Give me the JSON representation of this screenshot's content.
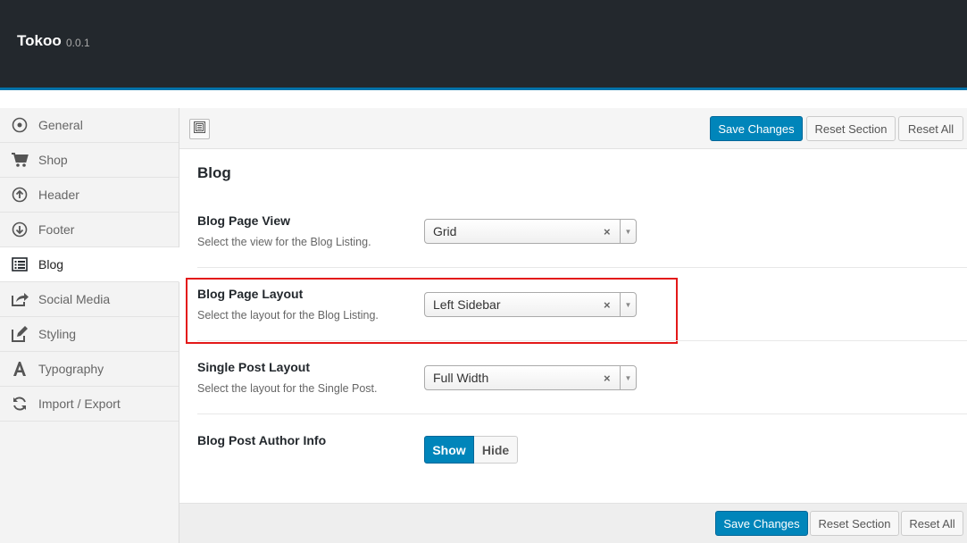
{
  "app": {
    "name": "Tokoo",
    "version": "0.0.1"
  },
  "sidebar": {
    "items": [
      {
        "label": "General",
        "icon": "circle-dot-icon"
      },
      {
        "label": "Shop",
        "icon": "cart-icon"
      },
      {
        "label": "Header",
        "icon": "arrow-up-circle-icon"
      },
      {
        "label": "Footer",
        "icon": "arrow-down-circle-icon"
      },
      {
        "label": "Blog",
        "icon": "list-icon",
        "active": true
      },
      {
        "label": "Social Media",
        "icon": "share-icon"
      },
      {
        "label": "Styling",
        "icon": "edit-icon"
      },
      {
        "label": "Typography",
        "icon": "font-icon"
      },
      {
        "label": "Import / Export",
        "icon": "refresh-icon"
      }
    ]
  },
  "toolbar": {
    "save": "Save Changes",
    "reset_section": "Reset Section",
    "reset_all": "Reset All"
  },
  "section": {
    "title": "Blog"
  },
  "fields": {
    "blog_page_view": {
      "label": "Blog Page View",
      "desc": "Select the view for the Blog Listing.",
      "value": "Grid"
    },
    "blog_page_layout": {
      "label": "Blog Page Layout",
      "desc": "Select the layout for the Blog Listing.",
      "value": "Left Sidebar"
    },
    "single_post_layout": {
      "label": "Single Post Layout",
      "desc": "Select the layout for the Single Post.",
      "value": "Full Width"
    },
    "author_info": {
      "label": "Blog Post Author Info",
      "on": "Show",
      "off": "Hide",
      "selected": "Show"
    }
  },
  "colors": {
    "accent": "#0085ba",
    "topbar": "#23282d",
    "highlight": "#e31919"
  }
}
